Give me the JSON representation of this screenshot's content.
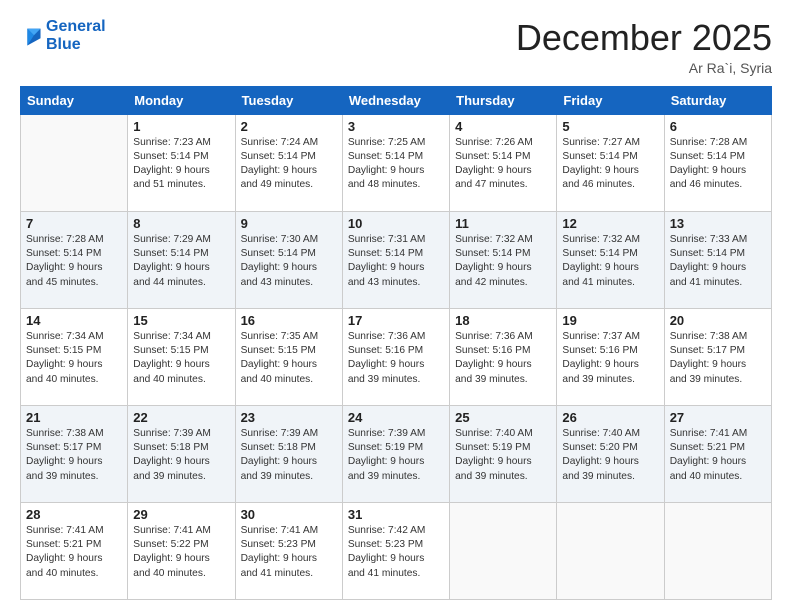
{
  "header": {
    "logo_line1": "General",
    "logo_line2": "Blue",
    "month_title": "December 2025",
    "location": "Ar Ra`i, Syria"
  },
  "days_of_week": [
    "Sunday",
    "Monday",
    "Tuesday",
    "Wednesday",
    "Thursday",
    "Friday",
    "Saturday"
  ],
  "weeks": [
    [
      {
        "day": "",
        "sunrise": "",
        "sunset": "",
        "daylight": ""
      },
      {
        "day": "1",
        "sunrise": "Sunrise: 7:23 AM",
        "sunset": "Sunset: 5:14 PM",
        "daylight": "Daylight: 9 hours and 51 minutes."
      },
      {
        "day": "2",
        "sunrise": "Sunrise: 7:24 AM",
        "sunset": "Sunset: 5:14 PM",
        "daylight": "Daylight: 9 hours and 49 minutes."
      },
      {
        "day": "3",
        "sunrise": "Sunrise: 7:25 AM",
        "sunset": "Sunset: 5:14 PM",
        "daylight": "Daylight: 9 hours and 48 minutes."
      },
      {
        "day": "4",
        "sunrise": "Sunrise: 7:26 AM",
        "sunset": "Sunset: 5:14 PM",
        "daylight": "Daylight: 9 hours and 47 minutes."
      },
      {
        "day": "5",
        "sunrise": "Sunrise: 7:27 AM",
        "sunset": "Sunset: 5:14 PM",
        "daylight": "Daylight: 9 hours and 46 minutes."
      },
      {
        "day": "6",
        "sunrise": "Sunrise: 7:28 AM",
        "sunset": "Sunset: 5:14 PM",
        "daylight": "Daylight: 9 hours and 46 minutes."
      }
    ],
    [
      {
        "day": "7",
        "sunrise": "Sunrise: 7:28 AM",
        "sunset": "Sunset: 5:14 PM",
        "daylight": "Daylight: 9 hours and 45 minutes."
      },
      {
        "day": "8",
        "sunrise": "Sunrise: 7:29 AM",
        "sunset": "Sunset: 5:14 PM",
        "daylight": "Daylight: 9 hours and 44 minutes."
      },
      {
        "day": "9",
        "sunrise": "Sunrise: 7:30 AM",
        "sunset": "Sunset: 5:14 PM",
        "daylight": "Daylight: 9 hours and 43 minutes."
      },
      {
        "day": "10",
        "sunrise": "Sunrise: 7:31 AM",
        "sunset": "Sunset: 5:14 PM",
        "daylight": "Daylight: 9 hours and 43 minutes."
      },
      {
        "day": "11",
        "sunrise": "Sunrise: 7:32 AM",
        "sunset": "Sunset: 5:14 PM",
        "daylight": "Daylight: 9 hours and 42 minutes."
      },
      {
        "day": "12",
        "sunrise": "Sunrise: 7:32 AM",
        "sunset": "Sunset: 5:14 PM",
        "daylight": "Daylight: 9 hours and 41 minutes."
      },
      {
        "day": "13",
        "sunrise": "Sunrise: 7:33 AM",
        "sunset": "Sunset: 5:14 PM",
        "daylight": "Daylight: 9 hours and 41 minutes."
      }
    ],
    [
      {
        "day": "14",
        "sunrise": "Sunrise: 7:34 AM",
        "sunset": "Sunset: 5:15 PM",
        "daylight": "Daylight: 9 hours and 40 minutes."
      },
      {
        "day": "15",
        "sunrise": "Sunrise: 7:34 AM",
        "sunset": "Sunset: 5:15 PM",
        "daylight": "Daylight: 9 hours and 40 minutes."
      },
      {
        "day": "16",
        "sunrise": "Sunrise: 7:35 AM",
        "sunset": "Sunset: 5:15 PM",
        "daylight": "Daylight: 9 hours and 40 minutes."
      },
      {
        "day": "17",
        "sunrise": "Sunrise: 7:36 AM",
        "sunset": "Sunset: 5:16 PM",
        "daylight": "Daylight: 9 hours and 39 minutes."
      },
      {
        "day": "18",
        "sunrise": "Sunrise: 7:36 AM",
        "sunset": "Sunset: 5:16 PM",
        "daylight": "Daylight: 9 hours and 39 minutes."
      },
      {
        "day": "19",
        "sunrise": "Sunrise: 7:37 AM",
        "sunset": "Sunset: 5:16 PM",
        "daylight": "Daylight: 9 hours and 39 minutes."
      },
      {
        "day": "20",
        "sunrise": "Sunrise: 7:38 AM",
        "sunset": "Sunset: 5:17 PM",
        "daylight": "Daylight: 9 hours and 39 minutes."
      }
    ],
    [
      {
        "day": "21",
        "sunrise": "Sunrise: 7:38 AM",
        "sunset": "Sunset: 5:17 PM",
        "daylight": "Daylight: 9 hours and 39 minutes."
      },
      {
        "day": "22",
        "sunrise": "Sunrise: 7:39 AM",
        "sunset": "Sunset: 5:18 PM",
        "daylight": "Daylight: 9 hours and 39 minutes."
      },
      {
        "day": "23",
        "sunrise": "Sunrise: 7:39 AM",
        "sunset": "Sunset: 5:18 PM",
        "daylight": "Daylight: 9 hours and 39 minutes."
      },
      {
        "day": "24",
        "sunrise": "Sunrise: 7:39 AM",
        "sunset": "Sunset: 5:19 PM",
        "daylight": "Daylight: 9 hours and 39 minutes."
      },
      {
        "day": "25",
        "sunrise": "Sunrise: 7:40 AM",
        "sunset": "Sunset: 5:19 PM",
        "daylight": "Daylight: 9 hours and 39 minutes."
      },
      {
        "day": "26",
        "sunrise": "Sunrise: 7:40 AM",
        "sunset": "Sunset: 5:20 PM",
        "daylight": "Daylight: 9 hours and 39 minutes."
      },
      {
        "day": "27",
        "sunrise": "Sunrise: 7:41 AM",
        "sunset": "Sunset: 5:21 PM",
        "daylight": "Daylight: 9 hours and 40 minutes."
      }
    ],
    [
      {
        "day": "28",
        "sunrise": "Sunrise: 7:41 AM",
        "sunset": "Sunset: 5:21 PM",
        "daylight": "Daylight: 9 hours and 40 minutes."
      },
      {
        "day": "29",
        "sunrise": "Sunrise: 7:41 AM",
        "sunset": "Sunset: 5:22 PM",
        "daylight": "Daylight: 9 hours and 40 minutes."
      },
      {
        "day": "30",
        "sunrise": "Sunrise: 7:41 AM",
        "sunset": "Sunset: 5:23 PM",
        "daylight": "Daylight: 9 hours and 41 minutes."
      },
      {
        "day": "31",
        "sunrise": "Sunrise: 7:42 AM",
        "sunset": "Sunset: 5:23 PM",
        "daylight": "Daylight: 9 hours and 41 minutes."
      },
      {
        "day": "",
        "sunrise": "",
        "sunset": "",
        "daylight": ""
      },
      {
        "day": "",
        "sunrise": "",
        "sunset": "",
        "daylight": ""
      },
      {
        "day": "",
        "sunrise": "",
        "sunset": "",
        "daylight": ""
      }
    ]
  ]
}
